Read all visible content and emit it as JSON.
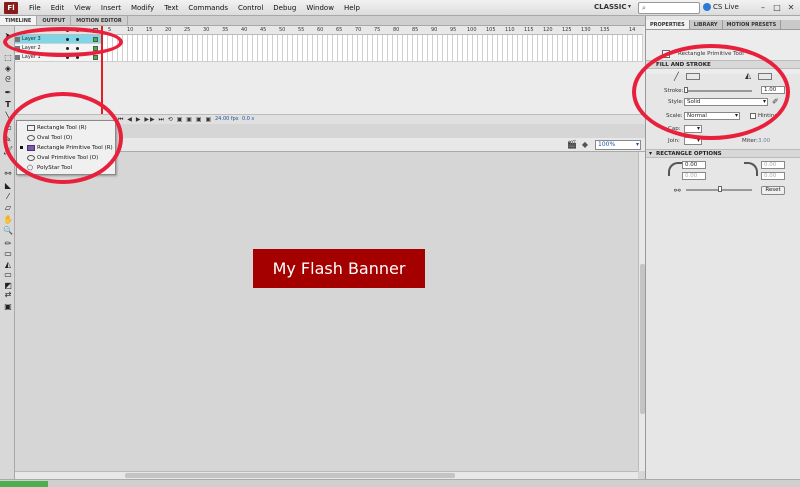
{
  "menubar": {
    "logo": "Fl",
    "items": [
      "File",
      "Edit",
      "View",
      "Insert",
      "Modify",
      "Text",
      "Commands",
      "Control",
      "Debug",
      "Window",
      "Help"
    ],
    "workspace": "CLASSIC",
    "search_placeholder": "",
    "cslive": "CS Live"
  },
  "timeline": {
    "tabs": [
      "TIMELINE",
      "OUTPUT",
      "MOTION EDITOR"
    ],
    "layers": [
      "Layer 3",
      "Layer 2",
      "Layer 1"
    ],
    "frame_numbers": [
      "5",
      "10",
      "15",
      "20",
      "25",
      "30",
      "35",
      "40",
      "45",
      "50",
      "55",
      "60",
      "65",
      "70",
      "75",
      "80",
      "85",
      "90",
      "95",
      "100",
      "105",
      "110",
      "115",
      "120",
      "125",
      "130",
      "135",
      "14"
    ],
    "fps": "24.00 fps",
    "time": "0.0 s"
  },
  "flyout": {
    "items": [
      "Rectangle Tool (R)",
      "Oval Tool (O)",
      "Rectangle Primitive Tool (R)",
      "Oval Primitive Tool (O)",
      "PolyStar Tool"
    ],
    "selected_index": 2
  },
  "stage": {
    "zoom": "100%",
    "banner_text": "My Flash Banner",
    "banner_color": "#a50000"
  },
  "panel": {
    "tabs": [
      "PROPERTIES",
      "LIBRARY",
      "MOTION PRESETS"
    ],
    "object_label": "Rectangle Primitive Tool",
    "fill_stroke": {
      "title": "FILL AND STROKE",
      "stroke_label": "Stroke:",
      "stroke_value": "1.00",
      "style_label": "Style:",
      "style_value": "Solid",
      "scale_label": "Scale:",
      "scale_value": "Normal",
      "hinting_label": "Hinting",
      "cap_label": "Cap:",
      "join_label": "Join:",
      "miter_label": "Miter:",
      "miter_value": "3.00"
    },
    "rect_options": {
      "title": "RECTANGLE OPTIONS",
      "corner_values": [
        "0.00",
        "0.00",
        "0.00",
        "0.00"
      ],
      "reset_label": "Reset"
    }
  },
  "annotation_color": "#e8203c"
}
